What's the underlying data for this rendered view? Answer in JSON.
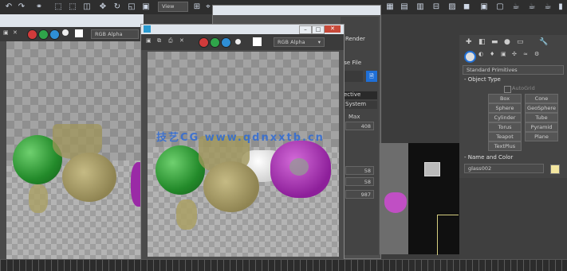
{
  "colors": {
    "accent": "#1f6fd6",
    "ui_bg": "#3c3c3c",
    "panel": "#444444",
    "title_bar": "#dfe5ec"
  },
  "toolbar": {
    "view_dropdown": "View"
  },
  "render_left": {
    "channel": "RGB Alpha"
  },
  "render_front": {
    "channel": "RGB Alpha"
  },
  "render_setup": {
    "render_label": "Render",
    "file_label": "ose File",
    "tab_effective": "ective",
    "tab_system": "System",
    "max_label": "Max",
    "fields": [
      "408",
      "58",
      "58",
      "987"
    ]
  },
  "right_panel": {
    "dropdown": "Standard Primitives",
    "object_type_header": "Object Type",
    "autogrid": "AutoGrid",
    "buttons": [
      "Box",
      "Cone",
      "Sphere",
      "GeoSphere",
      "Cylinder",
      "Tube",
      "Torus",
      "Pyramid",
      "Teapot",
      "Plane",
      "TextPlus"
    ],
    "name_color_header": "Name and Color",
    "name_value": "glass002",
    "object_color": "#f3e6a0"
  },
  "watermark": "技艺CG  www.qdnxxtb.cn",
  "icons": [
    "undo-icon",
    "redo-icon",
    "link-icon",
    "select-icon",
    "move-icon",
    "rotate-icon",
    "scale-icon",
    "render-icon",
    "teapot-icon"
  ]
}
